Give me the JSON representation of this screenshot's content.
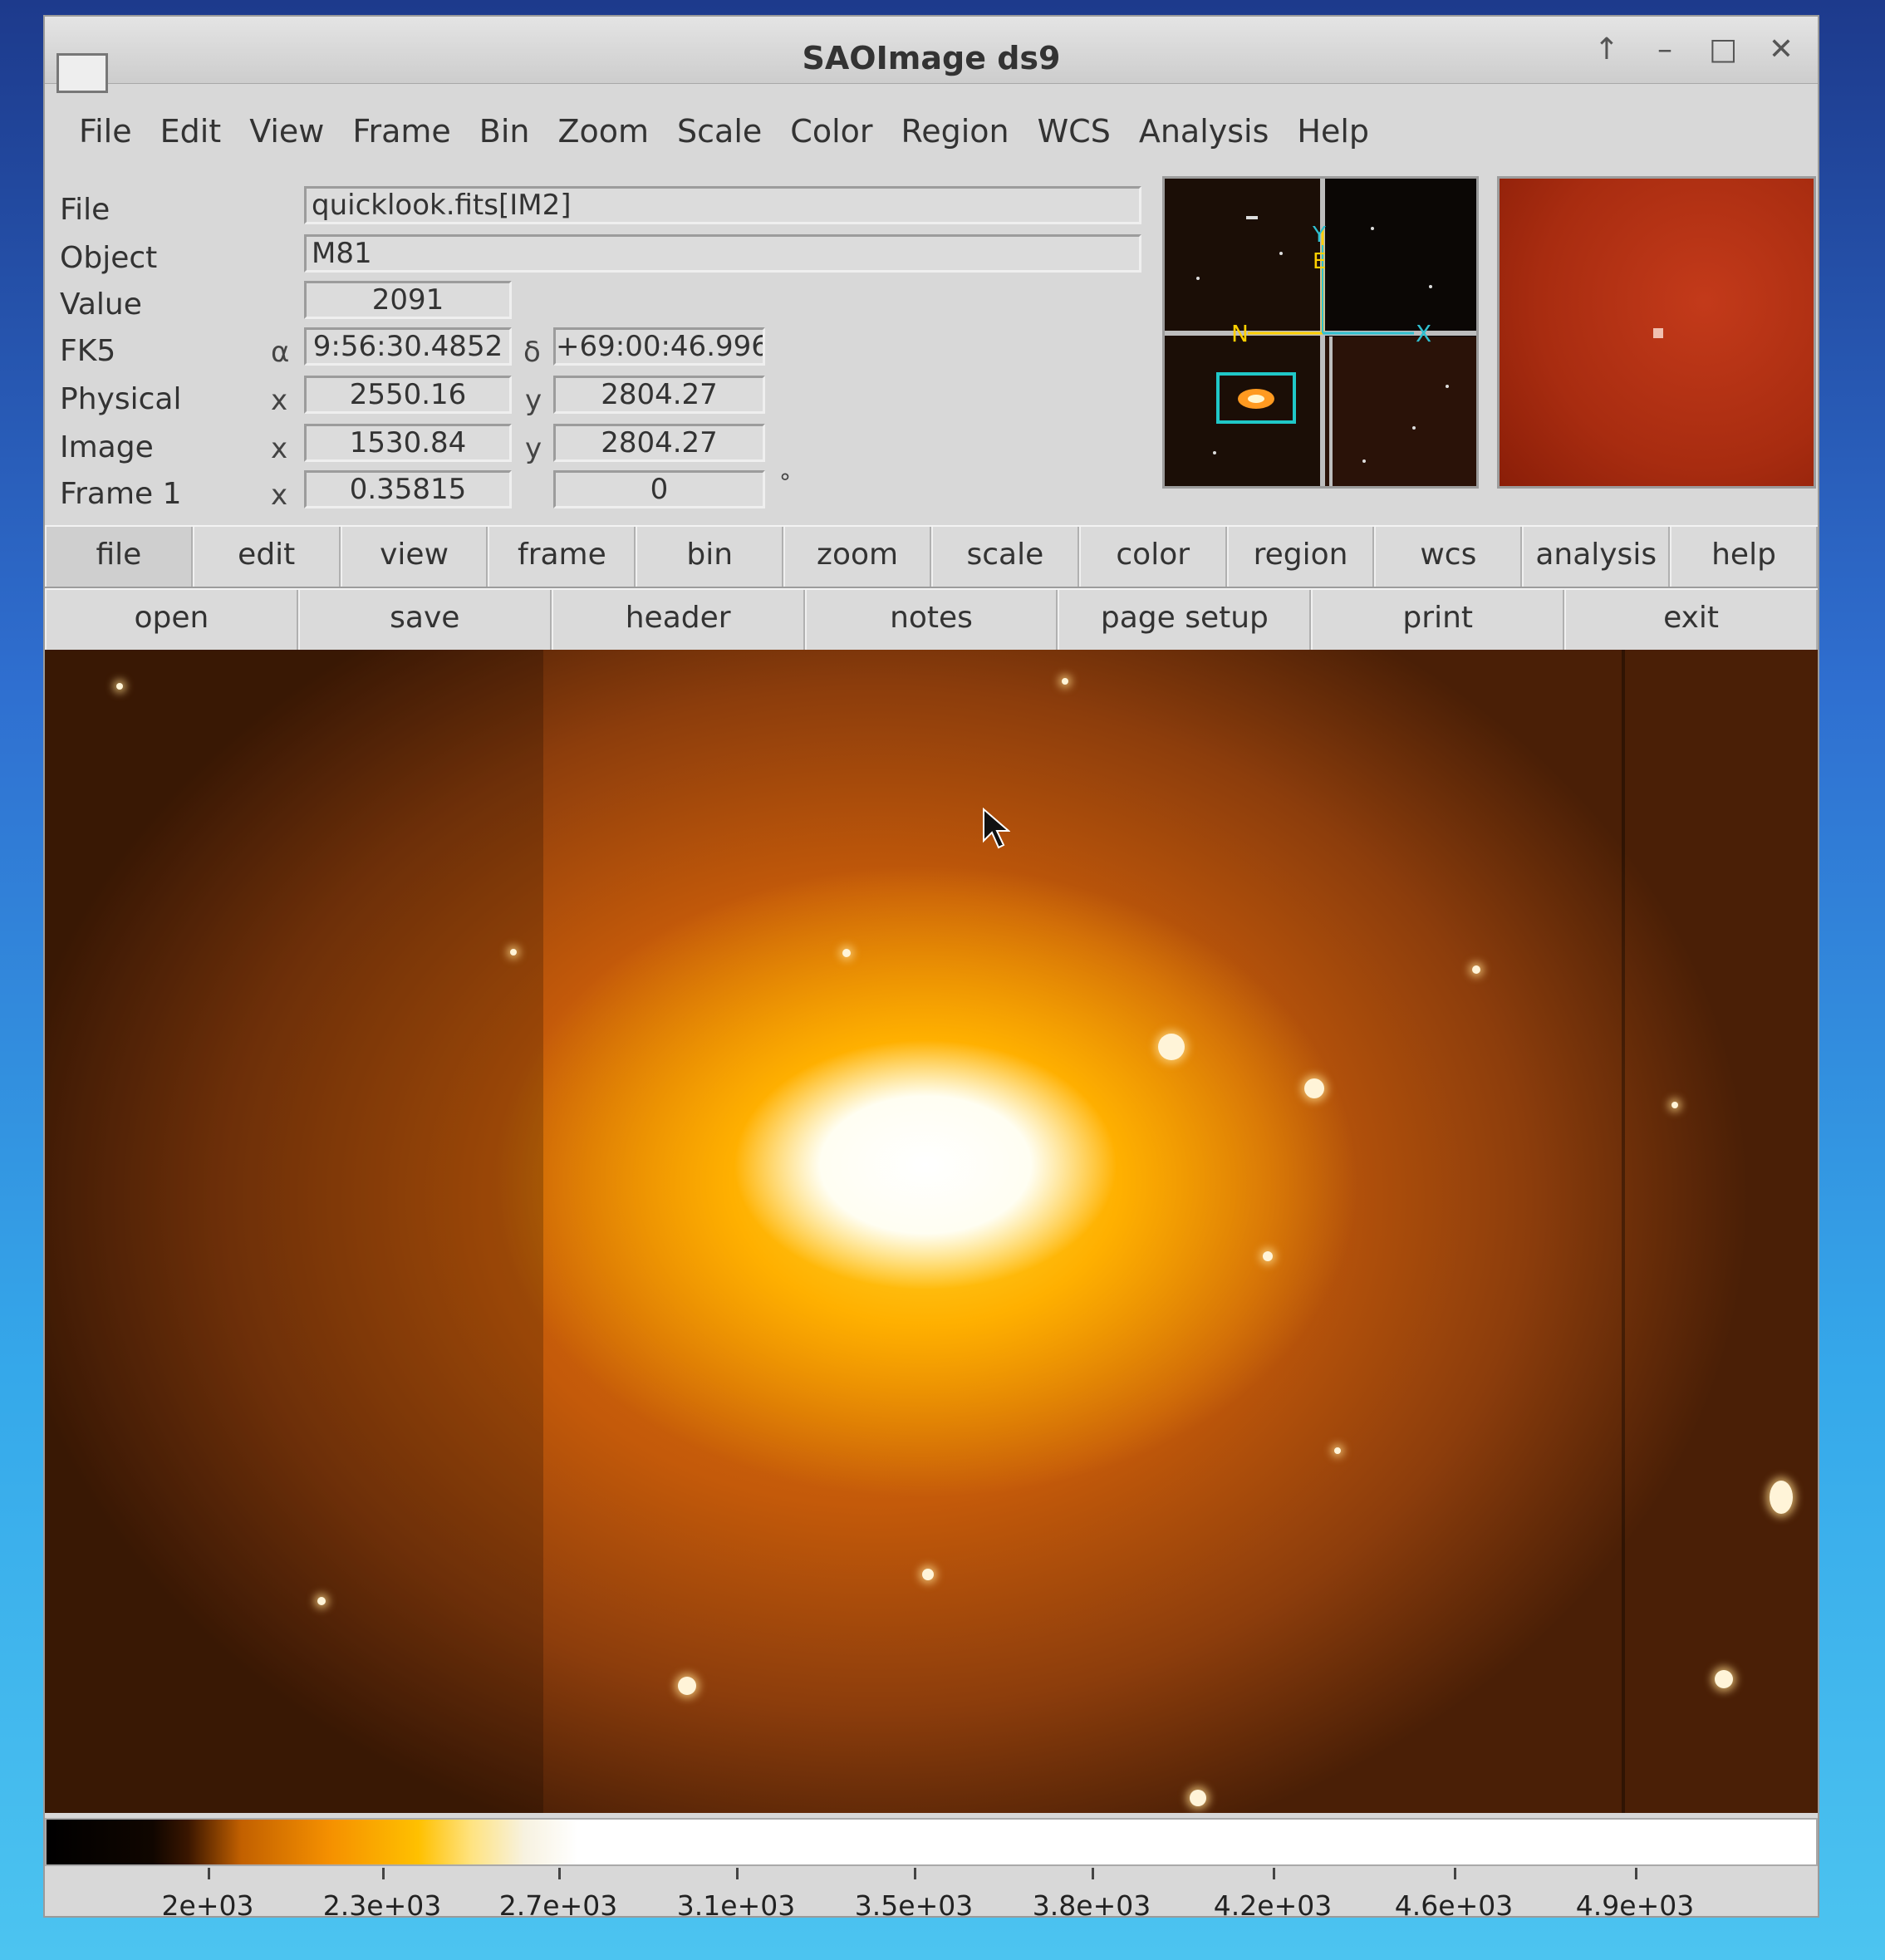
{
  "window": {
    "title": "SAOImage ds9",
    "controls": [
      "↑",
      "–",
      "□",
      "✕"
    ]
  },
  "menubar": [
    "File",
    "Edit",
    "View",
    "Frame",
    "Bin",
    "Zoom",
    "Scale",
    "Color",
    "Region",
    "WCS",
    "Analysis",
    "Help"
  ],
  "info": {
    "file_label": "File",
    "file_value": "quicklook.fits[IM2]",
    "object_label": "Object",
    "object_value": "M81",
    "value_label": "Value",
    "value_value": "2091",
    "fk5_label": "FK5",
    "alpha_sym": "α",
    "alpha_value": "9:56:30.4852",
    "delta_sym": "δ",
    "delta_value": "+69:00:46.996",
    "physical_label": "Physical",
    "physical_x_sym": "x",
    "physical_x": "2550.16",
    "physical_y_sym": "y",
    "physical_y": "2804.27",
    "image_label": "Image",
    "image_x_sym": "x",
    "image_x": "1530.84",
    "image_y_sym": "y",
    "image_y": "2804.27",
    "frame_label": "Frame 1",
    "frame_x_sym": "x",
    "frame_zoom": "0.35815",
    "frame_angle": "0",
    "degree_sym": "°"
  },
  "panner": {
    "labels": {
      "n": "N",
      "e": "E",
      "x": "X",
      "y": "Y"
    }
  },
  "buttonbar": [
    "file",
    "edit",
    "view",
    "frame",
    "bin",
    "zoom",
    "scale",
    "color",
    "region",
    "wcs",
    "analysis",
    "help"
  ],
  "subbuttons": [
    "open",
    "save",
    "header",
    "notes",
    "page setup",
    "print",
    "exit"
  ],
  "colorbar_ticks": [
    "2e+03",
    "2.3e+03",
    "2.7e+03",
    "3.1e+03",
    "3.5e+03",
    "3.8e+03",
    "4.2e+03",
    "4.6e+03",
    "4.9e+03"
  ],
  "colors": {
    "accent_panner_box": "#20c8c8",
    "panner_compass": "#ffd000",
    "panner_axes": "#30c0d0"
  }
}
